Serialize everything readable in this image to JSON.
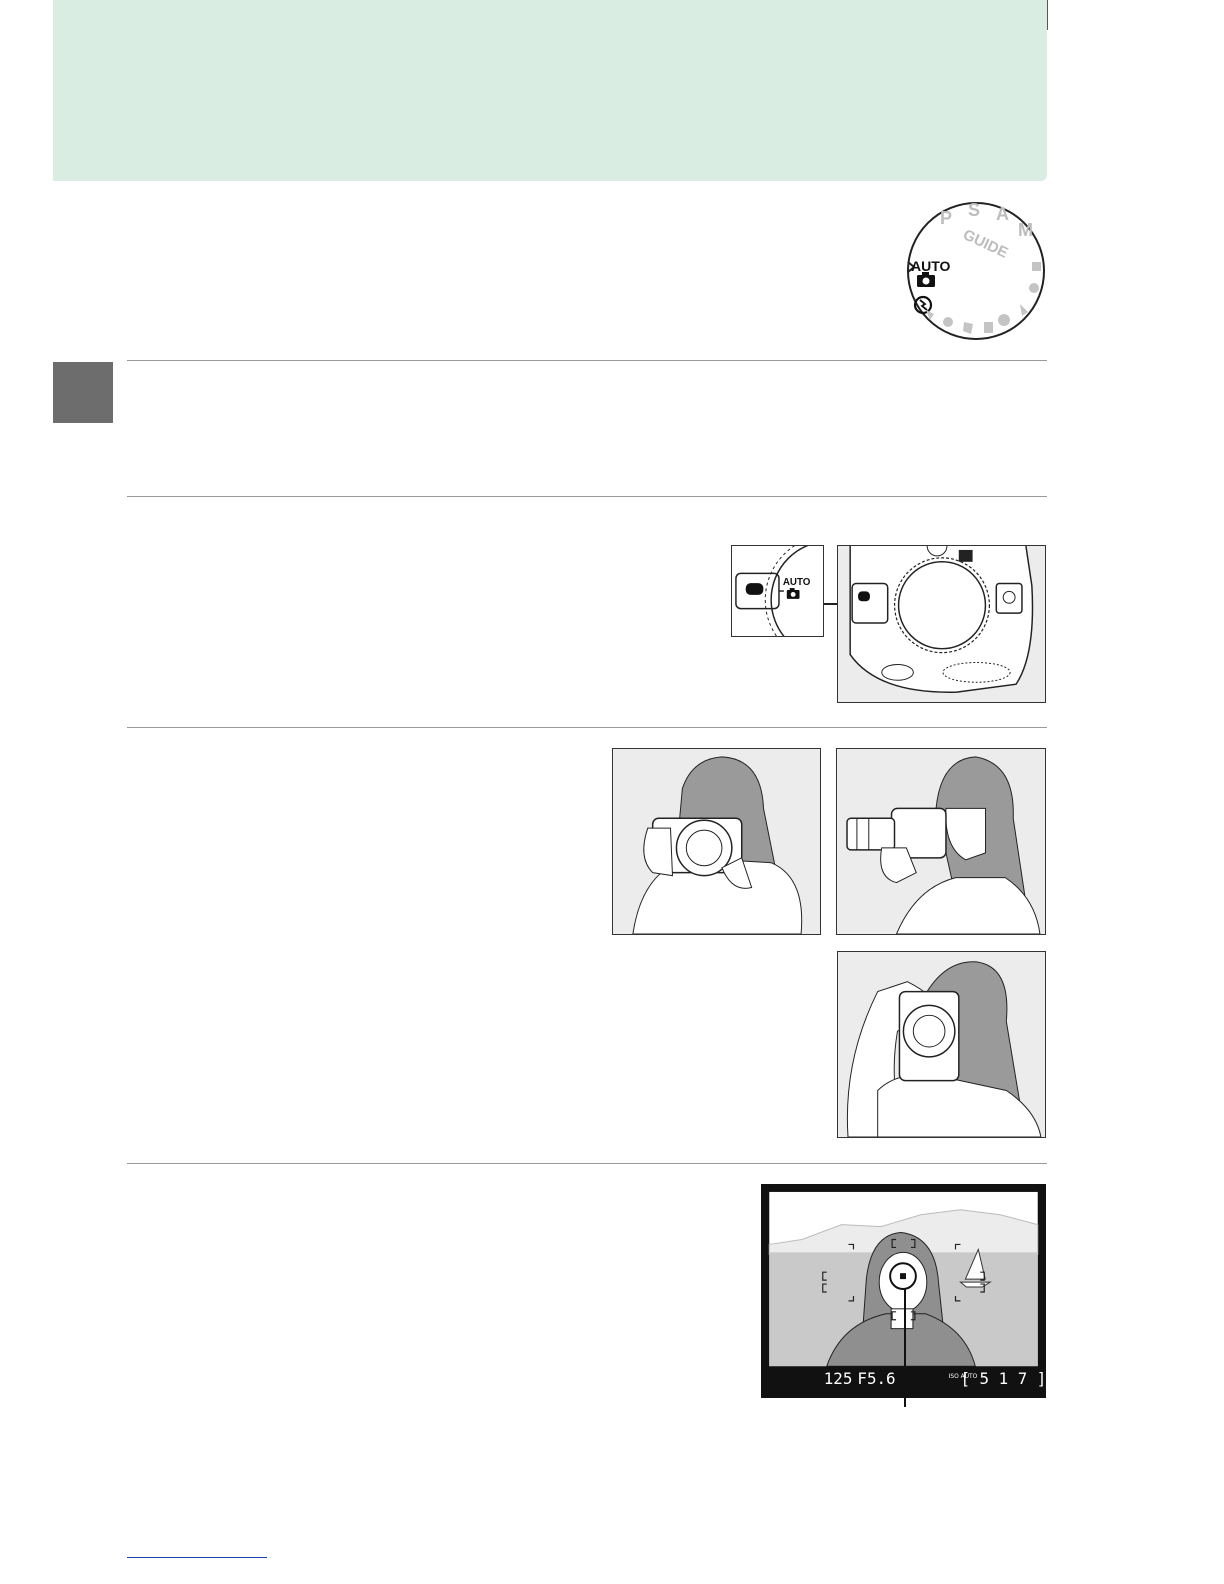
{
  "mode_dial": {
    "auto_label": "AUTO",
    "guide_label": "GUIDE",
    "mode_letters": [
      "P",
      "S",
      "A",
      "M"
    ]
  },
  "dial_closeup": {
    "auto_label": "AUTO"
  },
  "viewfinder": {
    "shutter_speed": "125",
    "aperture": "F5.6",
    "iso_label": "ISO AUTO",
    "exposures_remaining": "[ 5 1 7 ]"
  },
  "colors": {
    "header_band": "#d9ede3",
    "side_tab": "#6d6d6d",
    "rules": "#9a9a9a",
    "footer_link": "#1a3fb0"
  },
  "icons": [
    "camera-icon",
    "flash-off-icon"
  ]
}
